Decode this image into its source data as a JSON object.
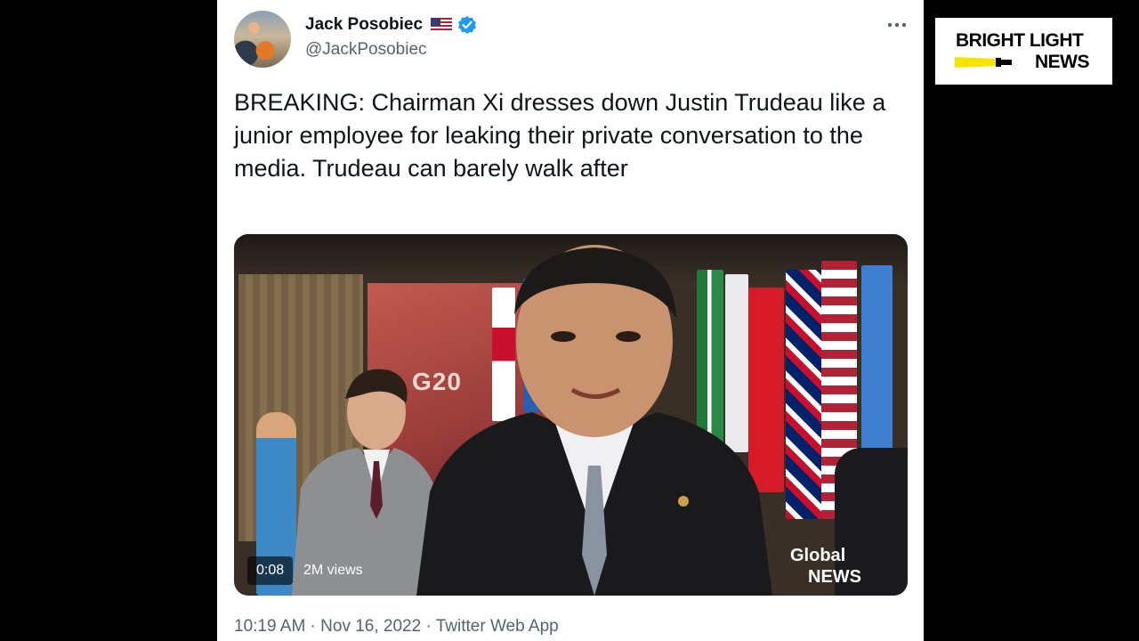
{
  "tweet": {
    "author_name": "Jack Posobiec",
    "handle": "@JackPosobiec",
    "text": "BREAKING: Chairman Xi dresses down Justin Trudeau like a junior employee for leaking their private conversation to the media. Trudeau can barely walk after",
    "meta": "10:19 AM · Nov 16, 2022 · Twitter Web App",
    "icons": [
      "us-flag-icon",
      "verified-icon",
      "more-icon"
    ]
  },
  "video": {
    "time": "0:08",
    "views": "2M views",
    "backdrop_text": "G20",
    "watermark_line1": "Global",
    "watermark_line2": "NEWS"
  },
  "brand": {
    "line1": "BRIGHT LIGHT",
    "line2": "NEWS",
    "accent_color": "#f5e400"
  },
  "colors": {
    "verified_blue": "#1d9bf0",
    "text_primary": "#0f1419",
    "text_secondary": "#536471"
  }
}
